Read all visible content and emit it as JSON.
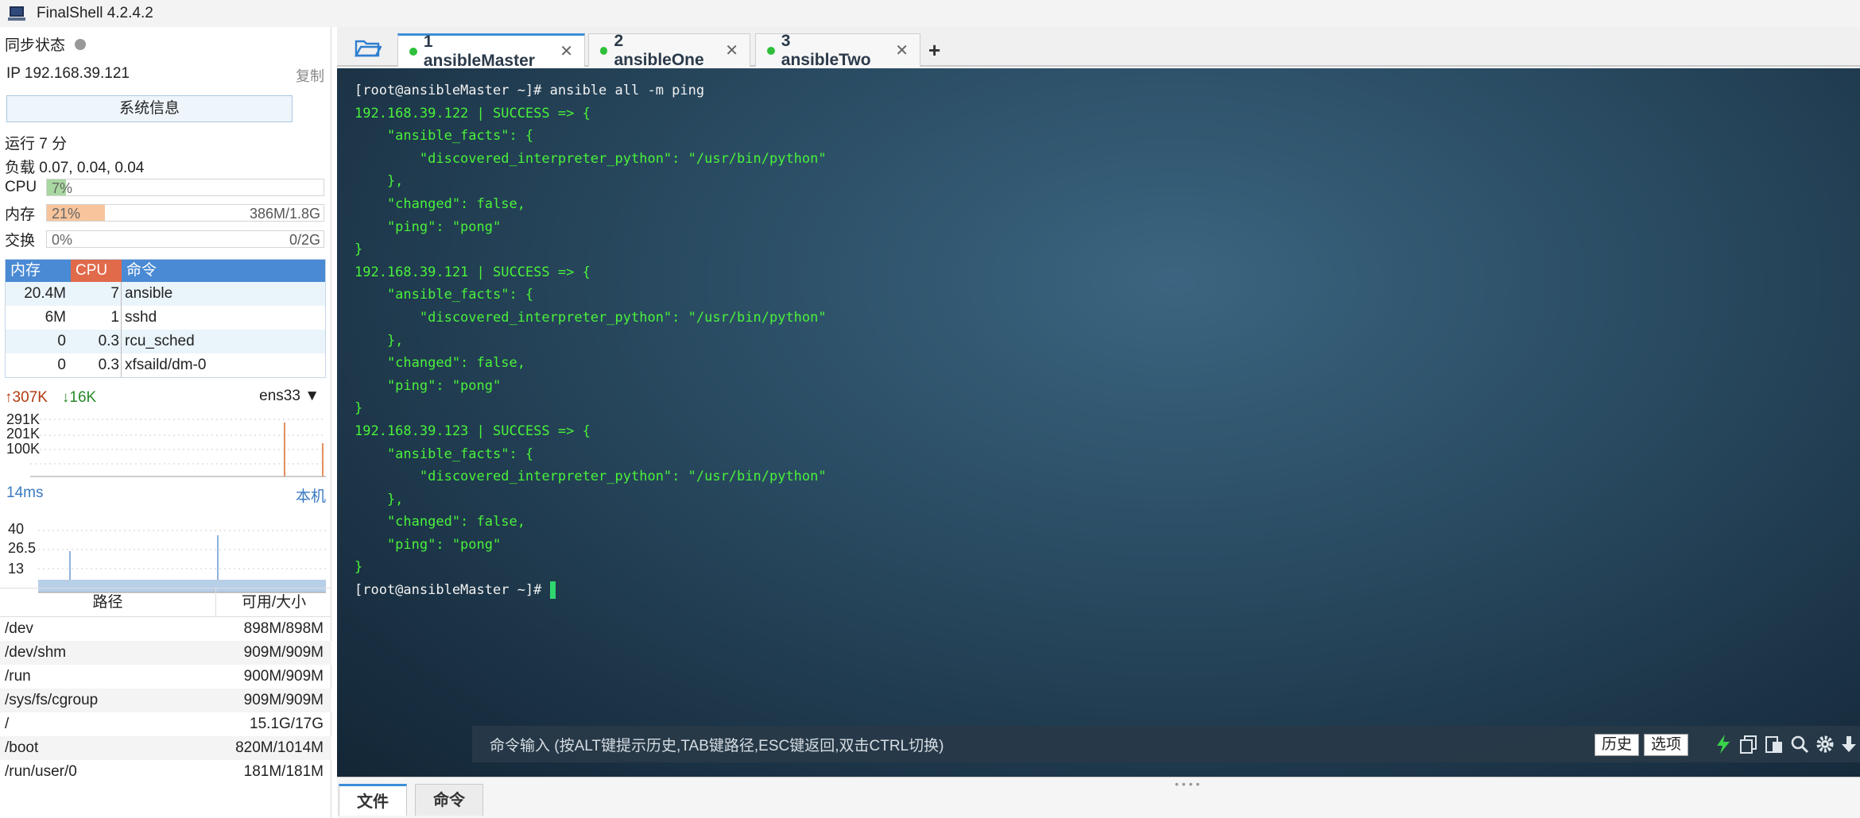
{
  "window": {
    "title": "FinalShell 4.2.4.2"
  },
  "sidebar": {
    "sync_label": "同步状态",
    "ip_label": "IP  192.168.39.121",
    "copy_label": "复制",
    "sysinfo_button": "系统信息",
    "uptime": "运行 7 分",
    "load": "负载 0.07, 0.04, 0.04",
    "cpu": {
      "label": "CPU",
      "percent_text": "7%",
      "fraction": 0.07
    },
    "mem": {
      "label": "内存",
      "percent_text": "21%",
      "amount": "386M/1.8G",
      "fraction": 0.21
    },
    "swap": {
      "label": "交换",
      "percent_text": "0%",
      "amount": "0/2G",
      "fraction": 0
    },
    "proc_headers": {
      "mem": "内存",
      "cpu": "CPU",
      "cmd": "命令"
    },
    "processes": [
      {
        "mem": "20.4M",
        "cpu": "7",
        "cmd": "ansible"
      },
      {
        "mem": "6M",
        "cpu": "1",
        "cmd": "sshd"
      },
      {
        "mem": "0",
        "cpu": "0.3",
        "cmd": "rcu_sched"
      },
      {
        "mem": "0",
        "cpu": "0.3",
        "cmd": "xfsaild/dm-0"
      }
    ],
    "net": {
      "up": "307K",
      "down": "16K",
      "iface": "ens33",
      "ticks": [
        "291K",
        "201K",
        "100K"
      ]
    },
    "ping": {
      "latency": "14ms",
      "target": "本机",
      "ticks": [
        "40",
        "26.5",
        "13"
      ]
    },
    "disk_headers": {
      "path": "路径",
      "size": "可用/大小"
    },
    "disks": [
      {
        "path": "/dev",
        "size": "898M/898M"
      },
      {
        "path": "/dev/shm",
        "size": "909M/909M"
      },
      {
        "path": "/run",
        "size": "900M/909M"
      },
      {
        "path": "/sys/fs/cgroup",
        "size": "909M/909M"
      },
      {
        "path": "/",
        "size": "15.1G/17G"
      },
      {
        "path": "/boot",
        "size": "820M/1014M"
      },
      {
        "path": "/run/user/0",
        "size": "181M/181M"
      }
    ]
  },
  "tabs": [
    {
      "label": "1 ansibleMaster",
      "active": true
    },
    {
      "label": "2 ansibleOne",
      "active": false
    },
    {
      "label": "3 ansibleTwo",
      "active": false
    }
  ],
  "terminal": {
    "lines": [
      {
        "text": "[root@ansibleMaster ~]# ansible all -m ping",
        "color": "white"
      },
      {
        "text": "192.168.39.122 | SUCCESS => {",
        "color": "green"
      },
      {
        "text": "    \"ansible_facts\": {",
        "color": "green"
      },
      {
        "text": "        \"discovered_interpreter_python\": \"/usr/bin/python\"",
        "color": "green"
      },
      {
        "text": "    },",
        "color": "green"
      },
      {
        "text": "    \"changed\": false,",
        "color": "green"
      },
      {
        "text": "    \"ping\": \"pong\"",
        "color": "green"
      },
      {
        "text": "}",
        "color": "green"
      },
      {
        "text": "192.168.39.121 | SUCCESS => {",
        "color": "green"
      },
      {
        "text": "    \"ansible_facts\": {",
        "color": "green"
      },
      {
        "text": "        \"discovered_interpreter_python\": \"/usr/bin/python\"",
        "color": "green"
      },
      {
        "text": "    },",
        "color": "green"
      },
      {
        "text": "    \"changed\": false,",
        "color": "green"
      },
      {
        "text": "    \"ping\": \"pong\"",
        "color": "green"
      },
      {
        "text": "}",
        "color": "green"
      },
      {
        "text": "192.168.39.123 | SUCCESS => {",
        "color": "green"
      },
      {
        "text": "    \"ansible_facts\": {",
        "color": "green"
      },
      {
        "text": "        \"discovered_interpreter_python\": \"/usr/bin/python\"",
        "color": "green"
      },
      {
        "text": "    },",
        "color": "green"
      },
      {
        "text": "    \"changed\": false,",
        "color": "green"
      },
      {
        "text": "    \"ping\": \"pong\"",
        "color": "green"
      },
      {
        "text": "}",
        "color": "green"
      }
    ],
    "prompt": "[root@ansibleMaster ~]# "
  },
  "command_bar": {
    "placeholder": "命令输入 (按ALT键提示历史,TAB键路径,ESC键返回,双击CTRL切换)",
    "history_button": "历史",
    "options_button": "选项",
    "icons": [
      "lightning-icon",
      "copy-icon",
      "paste-icon",
      "search-icon",
      "gear-icon",
      "down-arrow-icon"
    ]
  },
  "bottom_tabs": [
    {
      "label": "文件",
      "active": true
    },
    {
      "label": "命令",
      "active": false
    }
  ],
  "colors": {
    "accent": "#3d8ed8",
    "term_green": "#4af23a",
    "cpu_fill": "#a8d8a0",
    "mem_fill": "#f7c49c"
  }
}
